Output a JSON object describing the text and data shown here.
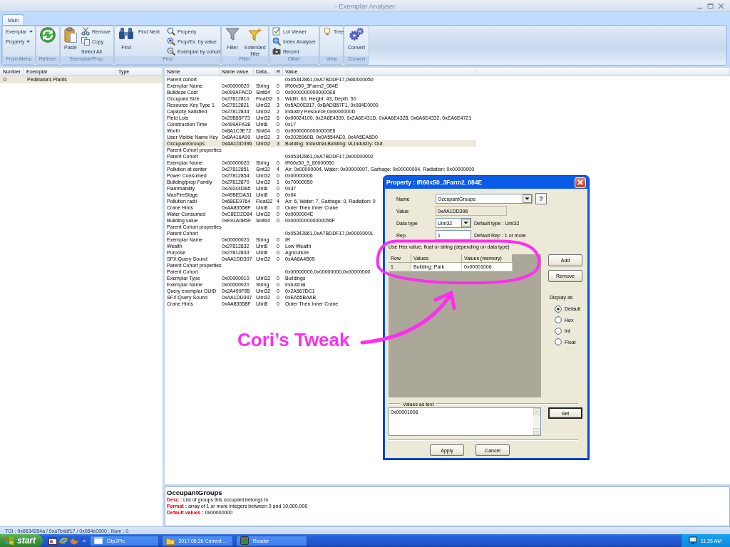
{
  "window": {
    "title": "- Exemplar Analyser"
  },
  "tabs": [
    {
      "label": "Main",
      "selected": true
    }
  ],
  "ribbon": {
    "groups": [
      {
        "label": "From Menu",
        "columns": [
          {
            "kind": "menus",
            "items": [
              {
                "label": "Exemplar"
              },
              {
                "label": "Property"
              }
            ]
          }
        ]
      },
      {
        "label": "Refresh",
        "columns": [
          {
            "kind": "large"
          }
        ]
      },
      {
        "label": "Exemplar/Prop.",
        "columns": [
          {
            "kind": "large",
            "label": "Paste"
          },
          {
            "kind": "stack",
            "items": [
              {
                "label": "Remove"
              },
              {
                "label": "Copy"
              },
              {
                "label": "Select All"
              }
            ]
          }
        ]
      },
      {
        "label": "Find",
        "columns": [
          {
            "kind": "large",
            "label": "Find"
          },
          {
            "kind": "stack",
            "items": [
              {
                "label": "Find Next"
              }
            ]
          },
          {
            "kind": "separator"
          },
          {
            "kind": "stack",
            "items": [
              {
                "label": "Property"
              },
              {
                "label": "Prop/Ex. by value"
              },
              {
                "label": "Exemplar by cohort"
              }
            ]
          }
        ]
      },
      {
        "label": "Filter",
        "columns": [
          {
            "kind": "large",
            "label": "Filter"
          },
          {
            "kind": "large",
            "label": "Extended filter"
          }
        ]
      },
      {
        "label": "Other",
        "columns": [
          {
            "kind": "stack",
            "items": [
              {
                "label": "Lot Viewer"
              },
              {
                "label": "Index Analyser"
              },
              {
                "label": "Record"
              }
            ]
          }
        ]
      },
      {
        "label": "View",
        "columns": [
          {
            "kind": "stack",
            "items": [
              {
                "label": "Tree"
              }
            ]
          }
        ]
      },
      {
        "label": "Convert",
        "columns": [
          {
            "kind": "large",
            "label": "Convert"
          }
        ]
      }
    ]
  },
  "exemplar_list": {
    "columns": [
      "Number",
      "Exemplar",
      "Type"
    ],
    "rows": [
      {
        "number": "0",
        "exemplar": "Pediriana's Plants",
        "selected": true
      }
    ]
  },
  "properties": {
    "columns": [
      "Name",
      "Name value",
      "Data...",
      "R",
      "Value"
    ],
    "rows": [
      {
        "name": "Parent cohort",
        "value": "0x05342861,0xA7BDDF17,0x80000050",
        "selected": false
      },
      {
        "name": "Exemplar Name",
        "name_value": "0x00000020",
        "data_type": "String",
        "rep": "0",
        "value": "IR60x50_3Farm2_084E",
        "selected": false
      },
      {
        "name": "Bulldoze Cost",
        "name_value": "0x099AFACD",
        "data_type": "Sint64",
        "rep": "0",
        "value": "0x00000000000000E6",
        "selected": false
      },
      {
        "name": "Occupant Size",
        "name_value": "0x27812810",
        "data_type": "Float32",
        "rep": "3",
        "value": "Width: 60, Height: 43, Depth: 50",
        "selected": false
      },
      {
        "name": "Resource Key Type 1",
        "name_value": "0x27812821",
        "data_type": "Uint32",
        "rep": "3",
        "value": "0x5AD0E817, 0xBADB57F1, 0x084E0000",
        "selected": false
      },
      {
        "name": "Capacity Satisfied",
        "name_value": "0x27812834",
        "data_type": "Uint32",
        "rep": "2",
        "value": "Industry Resource,0x0000000D",
        "selected": false
      },
      {
        "name": "Field Lots",
        "name_value": "0x29B55F73",
        "data_type": "Uint32",
        "rep": "6",
        "value": "0x00024100, 0x2A6E4309, 0x2A6E431D, 0xAA6E4328, 0x6A6E4332, 0xEA6E4721",
        "selected": false
      },
      {
        "name": "Construction Time",
        "name_value": "0x499AFA38",
        "data_type": "Uint8",
        "rep": "0",
        "value": "0x17",
        "selected": false
      },
      {
        "name": "Worth",
        "name_value": "0x8A1C3E72",
        "data_type": "Sint64",
        "rep": "0",
        "value": "0x00000000000000E6",
        "selected": false
      },
      {
        "name": "User Visible Name Key",
        "name_value": "0x8A416A99",
        "data_type": "Uint32",
        "rep": "3",
        "value": "0x2026960B, 0x0A554AE0, 0x4A5EA6D0",
        "selected": false
      },
      {
        "name": "OccupantGroups",
        "name_value": "0xAA1DD396",
        "data_type": "Uint32",
        "rep": "3",
        "value": "Building: Industrial,Building: IA,Industry: Out",
        "selected": true
      },
      {
        "name": "Parent Cohort properties",
        "selected": false
      },
      {
        "name": "Parent Cohort",
        "value": "0x05342861,0xA7BDDF17,0x00000002",
        "selected": false
      },
      {
        "name": "Exemplar Name",
        "name_value": "0x00000020",
        "data_type": "String",
        "rep": "0",
        "value": "IR60x50_3_80000050",
        "selected": false
      },
      {
        "name": "Pollution at center",
        "name_value": "0x27812851",
        "data_type": "Sint32",
        "rep": "4",
        "value": "Air: 0x00000004, Water: 0x00000007, Garbage: 0x00000004, Radiation: 0x00000000",
        "selected": false
      },
      {
        "name": "Power Consumed",
        "name_value": "0x27812854",
        "data_type": "Uint32",
        "rep": "0",
        "value": "0x00000006",
        "selected": false
      },
      {
        "name": "Building/prop Family",
        "name_value": "0x27812870",
        "data_type": "Uint32",
        "rep": "1",
        "value": "0x70000050",
        "selected": false
      },
      {
        "name": "Flammability",
        "name_value": "0x29244DB5",
        "data_type": "Uint8",
        "rep": "0",
        "value": "0x37",
        "selected": false
      },
      {
        "name": "MaxFireStage",
        "name_value": "0x49BEDA31",
        "data_type": "Uint8",
        "rep": "0",
        "value": "0x04",
        "selected": false
      },
      {
        "name": "Pollution radii",
        "name_value": "0x68EE9764",
        "data_type": "Float32",
        "rep": "4",
        "value": "Air: 6, Water: 7, Garbage: 0, Radiation: 0",
        "selected": false
      },
      {
        "name": "Crane Hints",
        "name_value": "0xAA83558F",
        "data_type": "Uint8",
        "rep": "0",
        "value": "Outer Then Inner Crane",
        "selected": false
      },
      {
        "name": "Water Consumed",
        "name_value": "0xC8ED2D84",
        "data_type": "Uint32",
        "rep": "0",
        "value": "0x0000004E",
        "selected": false
      },
      {
        "name": "Building value",
        "name_value": "0xE91A0B5F",
        "data_type": "Sint64",
        "rep": "0",
        "value": "0x000000000000056F",
        "selected": false
      },
      {
        "name": "Parent Cohort properties",
        "selected": false
      },
      {
        "name": "Parent Cohort",
        "value": "0x05342861,0xA7BDDF17,0x00000001",
        "selected": false
      },
      {
        "name": "Exemplar Name",
        "name_value": "0x00000020",
        "data_type": "String",
        "rep": "0",
        "value": "IR",
        "selected": false
      },
      {
        "name": "Wealth",
        "name_value": "0x27812832",
        "data_type": "Uint8",
        "rep": "0",
        "value": "Low Wealth",
        "selected": false
      },
      {
        "name": "Purpose",
        "name_value": "0x27812833",
        "data_type": "Uint8",
        "rep": "0",
        "value": "Agriculture",
        "selected": false
      },
      {
        "name": "SFX:Query Sound",
        "name_value": "0xAA1DD397",
        "data_type": "Uint32",
        "rep": "0",
        "value": "0xAA8A4B05",
        "selected": false
      },
      {
        "name": "Parent Cohort properties",
        "selected": false
      },
      {
        "name": "Parent Cohort",
        "value": "0x00000000,0x00000000,0x00000000",
        "selected": false
      },
      {
        "name": "Exemplar Type",
        "name_value": "0x00000010",
        "data_type": "Uint32",
        "rep": "0",
        "value": "Buildings",
        "selected": false
      },
      {
        "name": "Exemplar Name",
        "name_value": "0x00000020",
        "data_type": "String",
        "rep": "0",
        "value": "Industrial",
        "selected": false
      },
      {
        "name": "Query exemplar GUID",
        "name_value": "0x2A499F85",
        "data_type": "Uint32",
        "rep": "0",
        "value": "0x2A567DC1",
        "selected": false
      },
      {
        "name": "SFX:Query Sound",
        "name_value": "0xAA1DD397",
        "data_type": "Uint32",
        "rep": "0",
        "value": "0xEA55BAAB",
        "selected": false
      },
      {
        "name": "Crane Hints",
        "name_value": "0xAA83558F",
        "data_type": "Uint8",
        "rep": "0",
        "value": "Outer Then Inner Crane",
        "selected": false
      }
    ]
  },
  "description": {
    "title": "OccupantGroups",
    "lines": [
      "**Desc :** List of groups this occupant belongs to.",
      "**Format :** array of 1 or more integers between 0 and 10,000,000",
      "**Default values :** 0x00000000"
    ]
  },
  "status_bar": {
    "text": "TGI : 0x6534284a / 0xa7bddf17 / 0x084e0000 ; Num : 0"
  },
  "property_dialog": {
    "title": "Property : IR60x50_3Farm2_084E",
    "fields": [
      {
        "kind": "combo",
        "label": "Name",
        "value": "OccupantGroups",
        "button": "?"
      },
      {
        "kind": "readonly",
        "label": "Value",
        "value": "0xAA1DD396"
      },
      {
        "kind": "combo",
        "label": "Data type",
        "value": "Uint32",
        "note": "Default type : Uint32"
      },
      {
        "kind": "text",
        "label": "Rep.",
        "value": "1",
        "note": "Default Rep : 1 or more"
      }
    ],
    "hint": "Use Hex value, float or string (depending on data type)",
    "grid": {
      "columns": [
        "Row",
        "Values",
        "Values (memory)"
      ],
      "rows": [
        {
          "cells": [
            "1",
            "Building: Park",
            "0x00001006"
          ]
        }
      ]
    },
    "side_buttons": [
      "Add",
      "Remove"
    ],
    "display_as": {
      "label": "Display as",
      "options": [
        {
          "label": "Default",
          "selected": true
        },
        {
          "label": "Hex",
          "selected": false
        },
        {
          "label": "Int",
          "selected": false
        },
        {
          "label": "Float",
          "selected": false
        }
      ]
    },
    "values_as_text": {
      "label": "Values as text",
      "value": "0x00001006",
      "button": "Set"
    },
    "buttons": [
      "Apply",
      "Cancel"
    ]
  },
  "annotation": {
    "text": "Cori’s Tweak"
  },
  "taskbar": {
    "start_label": "start",
    "more": "»",
    "tasks": [
      {
        "label": "Clip2Pic",
        "selected": false
      },
      {
        "label": "2017.06.26 Current ...",
        "selected": false
      },
      {
        "label": "Reader",
        "selected": false
      }
    ],
    "clock": "11:25 AM"
  }
}
